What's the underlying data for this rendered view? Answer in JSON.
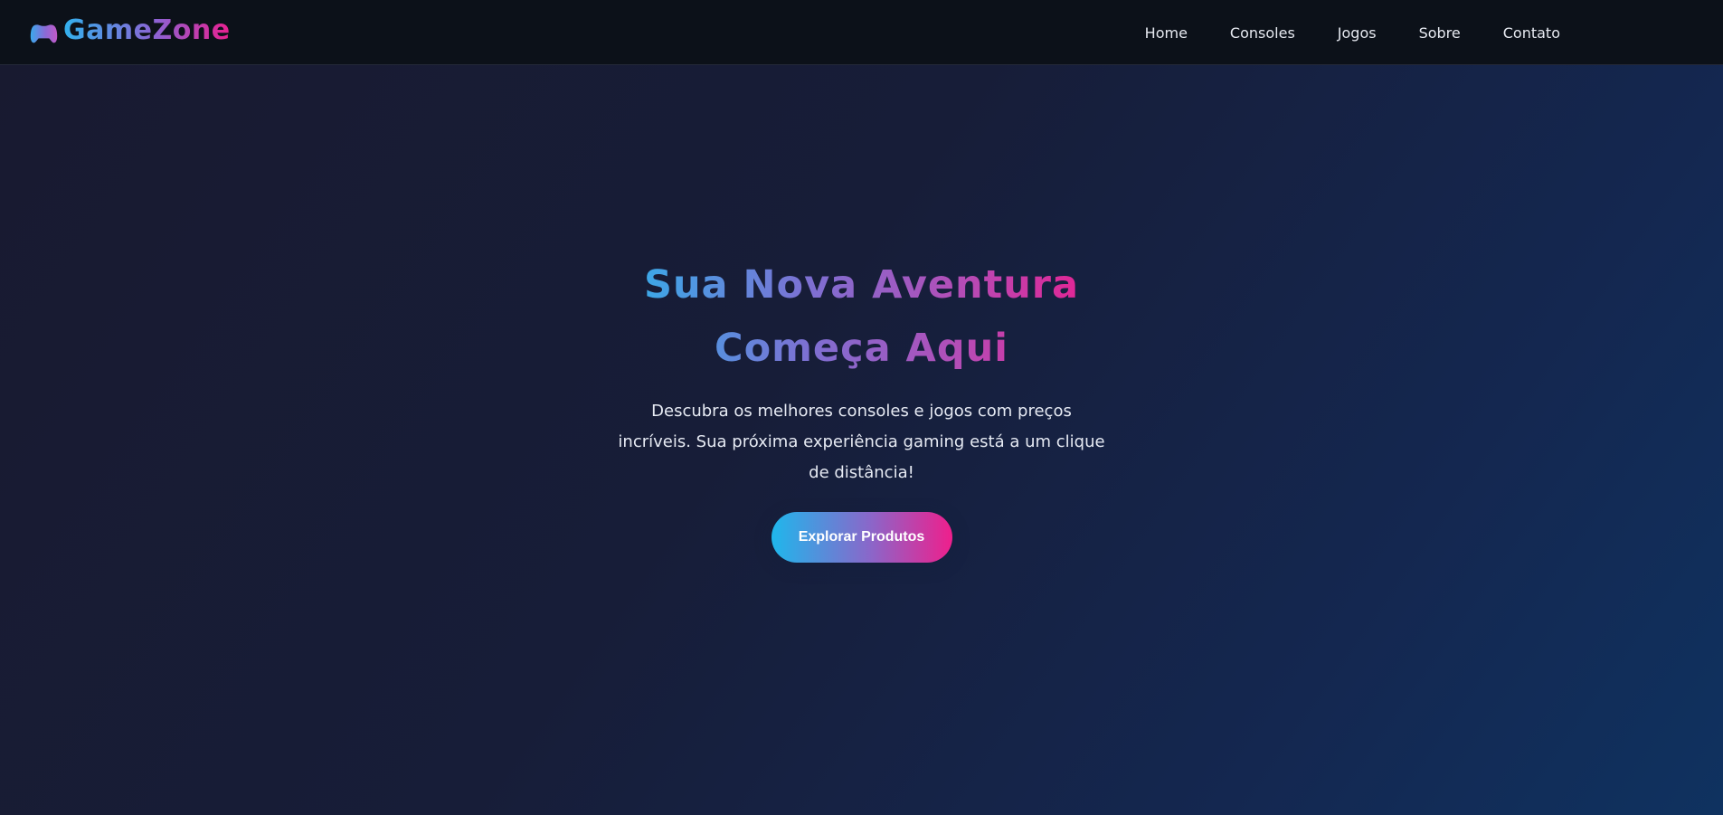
{
  "header": {
    "brand": "GameZone",
    "logo_icon": "gamepad-icon",
    "nav": [
      {
        "label": "Home"
      },
      {
        "label": "Consoles"
      },
      {
        "label": "Jogos"
      },
      {
        "label": "Sobre"
      },
      {
        "label": "Contato"
      }
    ]
  },
  "hero": {
    "title": "Sua Nova Aventura Começa Aqui",
    "subtitle": "Descubra os melhores consoles e jogos com preços incríveis. Sua próxima experiência gaming está a um clique de distância!",
    "cta_label": "Explorar Produtos"
  },
  "colors": {
    "accent_cyan": "#1fb7ec",
    "accent_purple": "#8b66c9",
    "accent_pink": "#ef1f8c",
    "navbar_bg": "#0c1119"
  }
}
